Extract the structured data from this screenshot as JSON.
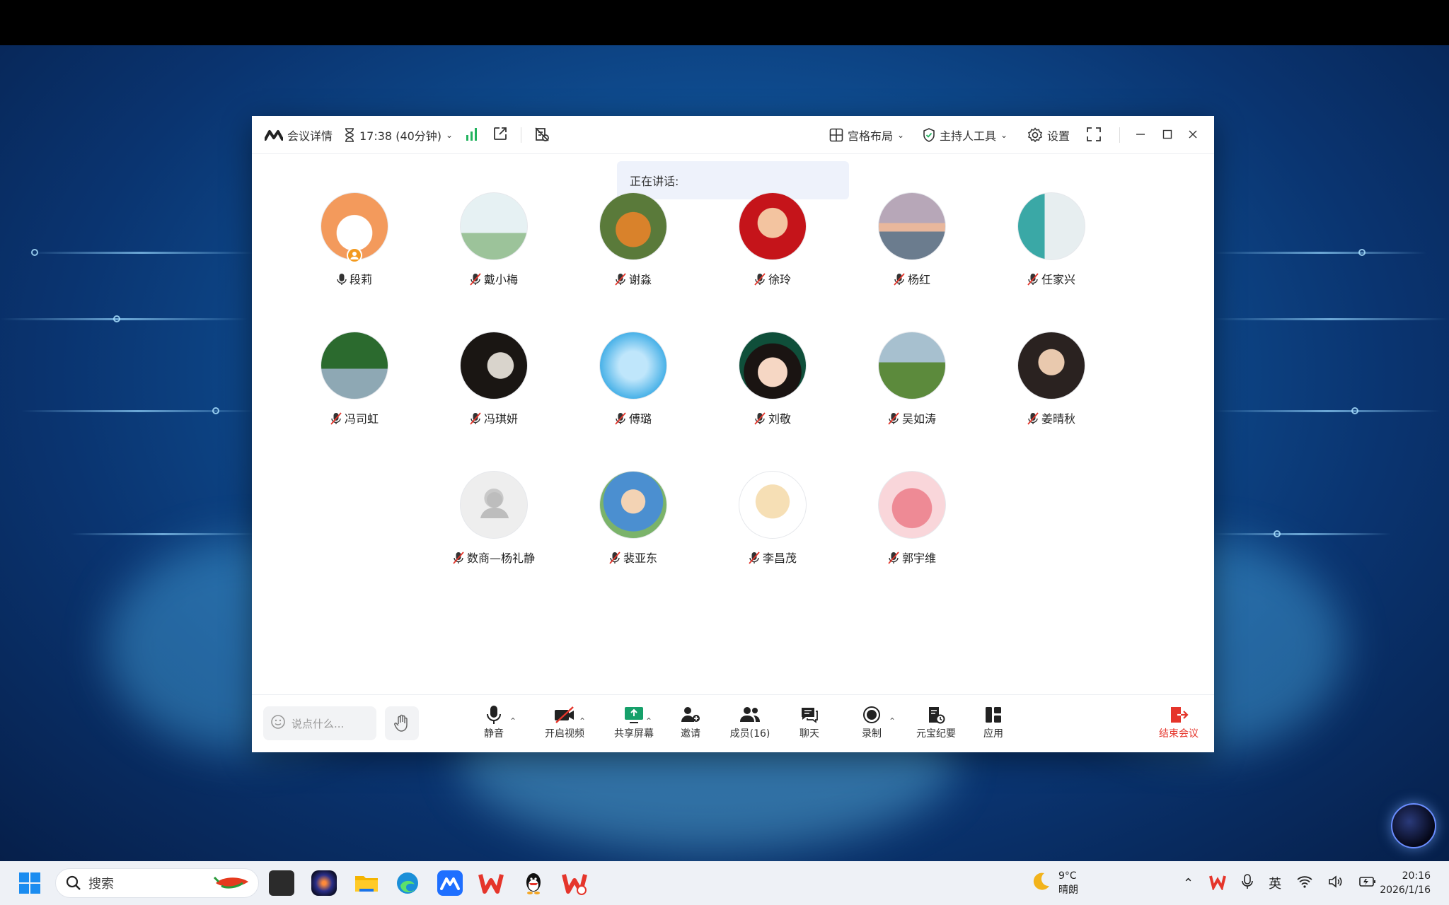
{
  "window": {
    "meeting_details": "会议详情",
    "timer": "17:38 (40分钟)",
    "layout": "宫格布局",
    "host_tools": "主持人工具",
    "settings": "设置"
  },
  "speaking_label": "正在讲话:",
  "participants": [
    {
      "name": "段莉",
      "mic": "on"
    },
    {
      "name": "戴小梅",
      "mic": "off"
    },
    {
      "name": "谢淼",
      "mic": "off"
    },
    {
      "name": "徐玲",
      "mic": "off"
    },
    {
      "name": "杨红",
      "mic": "off"
    },
    {
      "name": "任家兴",
      "mic": "off"
    },
    {
      "name": "冯司虹",
      "mic": "off"
    },
    {
      "name": "冯琪妍",
      "mic": "off"
    },
    {
      "name": "傅璐",
      "mic": "off"
    },
    {
      "name": "刘敬",
      "mic": "off"
    },
    {
      "name": "吴如涛",
      "mic": "off"
    },
    {
      "name": "姜晴秋",
      "mic": "off"
    },
    {
      "name": "数商—杨礼静",
      "mic": "off"
    },
    {
      "name": "裴亚东",
      "mic": "off"
    },
    {
      "name": "李昌茂",
      "mic": "off"
    },
    {
      "name": "郭宇维",
      "mic": "off"
    }
  ],
  "toolbar": {
    "chat_placeholder": "说点什么...",
    "mute": "静音",
    "video": "开启视频",
    "share": "共享屏幕",
    "invite": "邀请",
    "members": "成员(16)",
    "chat": "聊天",
    "record": "录制",
    "summary": "元宝纪要",
    "apps": "应用",
    "end": "结束会议"
  },
  "taskbar": {
    "search": "搜索",
    "weather_temp": "9°C",
    "weather_desc": "晴朗",
    "ime": "英",
    "time": "20:16",
    "date": "2026/1/16"
  },
  "colors": {
    "accent": "#2b6cff",
    "end": "#e5352b",
    "signal": "#22b35e"
  }
}
